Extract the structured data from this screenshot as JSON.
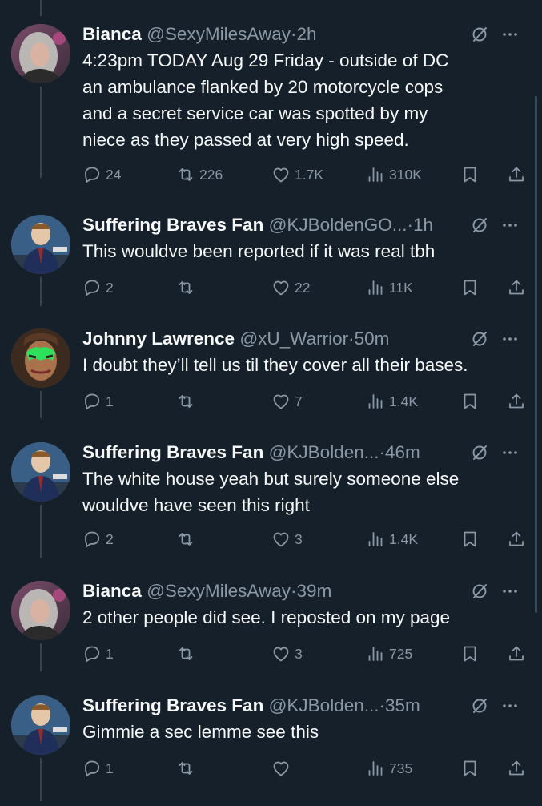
{
  "colors": {
    "background": "#15202b",
    "text": "#f7f9f9",
    "muted": "#8b98a5",
    "thread_line": "#38444d"
  },
  "tweets": [
    {
      "name": "Bianca",
      "handle": "@SexyMilesAway",
      "time": "2h",
      "lines": [
        "4:23pm TODAY Aug 29 Friday - outside of DC",
        "an ambulance flanked by 20 motorcycle cops",
        "and a secret service car was spotted by my",
        "niece as they passed at very high speed."
      ],
      "replies": "24",
      "reposts": "226",
      "likes": "1.7K",
      "views": "310K",
      "avatar": "bianca-avatar"
    },
    {
      "name": "Suffering Braves Fan",
      "handle": "@KJBoldenGO...",
      "time": "1h",
      "lines": [
        "This wouldve been reported if it was real tbh"
      ],
      "replies": "2",
      "reposts": "",
      "likes": "22",
      "views": "11K",
      "avatar": "braves-fan-avatar"
    },
    {
      "name": "Johnny Lawrence",
      "handle": "@xU_Warrior",
      "time": "50m",
      "lines": [
        "I doubt they’ll tell us til they cover all their bases."
      ],
      "replies": "1",
      "reposts": "",
      "likes": "7",
      "views": "1.4K",
      "avatar": "warrior-avatar"
    },
    {
      "name": "Suffering Braves Fan",
      "handle": "@KJBolden...",
      "time": "46m",
      "lines": [
        "The white house yeah but surely someone else",
        "wouldve have seen this right"
      ],
      "replies": "2",
      "reposts": "",
      "likes": "3",
      "views": "1.4K",
      "avatar": "braves-fan-avatar"
    },
    {
      "name": "Bianca",
      "handle": "@SexyMilesAway",
      "time": "39m",
      "lines": [
        "2 other people did see.  I reposted on my page"
      ],
      "replies": "1",
      "reposts": "",
      "likes": "3",
      "views": "725",
      "avatar": "bianca-avatar"
    },
    {
      "name": "Suffering Braves Fan",
      "handle": "@KJBolden...",
      "time": "35m",
      "lines": [
        "Gimmie a sec lemme see this"
      ],
      "replies": "1",
      "reposts": "",
      "likes": "",
      "views": "735",
      "avatar": "braves-fan-avatar"
    }
  ]
}
